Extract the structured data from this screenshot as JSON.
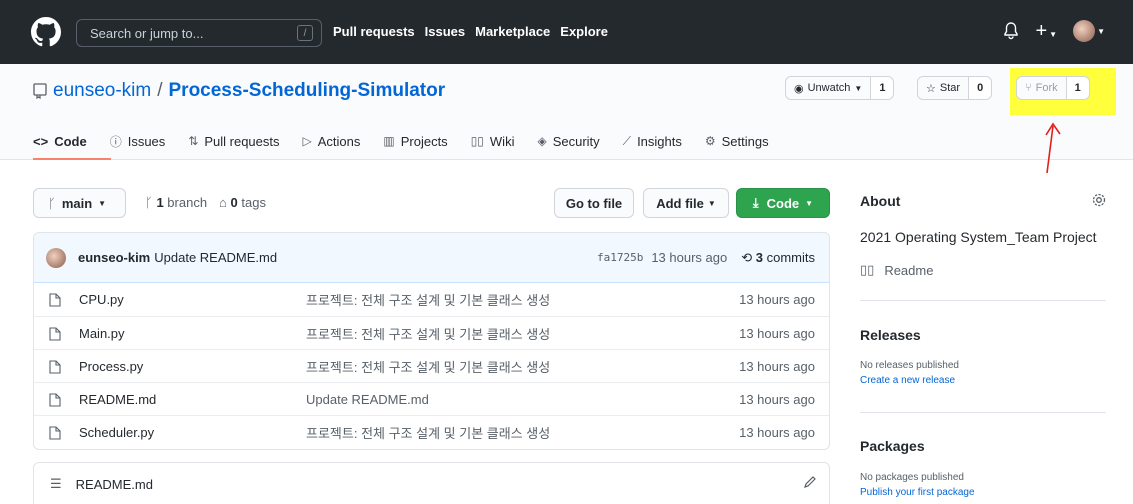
{
  "topnav": {
    "search_placeholder": "Search or jump to...",
    "search_shortcut": "/",
    "links": [
      "Pull requests",
      "Issues",
      "Marketplace",
      "Explore"
    ],
    "plus": "+"
  },
  "repo": {
    "owner": "eunseo-kim",
    "separator": "/",
    "name": "Process-Scheduling-Simulator",
    "unwatch_label": "Unwatch",
    "unwatch_count": "1",
    "star_label": "Star",
    "star_count": "0",
    "fork_label": "Fork",
    "fork_count": "1"
  },
  "tabs": [
    "Code",
    "Issues",
    "Pull requests",
    "Actions",
    "Projects",
    "Wiki",
    "Security",
    "Insights",
    "Settings"
  ],
  "branch": {
    "current": "main",
    "branch_count": "1",
    "branch_label": "branch",
    "tag_count": "0",
    "tag_label": "tags"
  },
  "actions": {
    "goto_file": "Go to file",
    "add_file": "Add file",
    "code": "Code"
  },
  "latest_commit": {
    "author": "eunseo-kim",
    "message": "Update README.md",
    "sha": "fa1725b",
    "age": "13 hours ago",
    "commit_count": "3",
    "commit_label": "commits"
  },
  "files": [
    {
      "name": "CPU.py",
      "message": "프로젝트: 전체 구조 설계 및 기본 클래스 생성",
      "age": "13 hours ago"
    },
    {
      "name": "Main.py",
      "message": "프로젝트: 전체 구조 설계 및 기본 클래스 생성",
      "age": "13 hours ago"
    },
    {
      "name": "Process.py",
      "message": "프로젝트: 전체 구조 설계 및 기본 클래스 생성",
      "age": "13 hours ago"
    },
    {
      "name": "README.md",
      "message": "Update README.md",
      "age": "13 hours ago"
    },
    {
      "name": "Scheduler.py",
      "message": "프로젝트: 전체 구조 설계 및 기본 클래스 생성",
      "age": "13 hours ago"
    }
  ],
  "readme_header": "README.md",
  "sidebar": {
    "about_title": "About",
    "description": "2021 Operating System_Team Project",
    "readme_label": "Readme",
    "releases_title": "Releases",
    "releases_none": "No releases published",
    "releases_link": "Create a new release",
    "packages_title": "Packages",
    "packages_none": "No packages published",
    "packages_link": "Publish your first package"
  },
  "colors": {
    "topnav_bg": "#24292e",
    "link_blue": "#0366d6",
    "code_button_green": "#2ea44f",
    "highlight_yellow": "#ffff3b",
    "annotation_red": "#e0201c",
    "tab_underline": "#f9826c"
  }
}
